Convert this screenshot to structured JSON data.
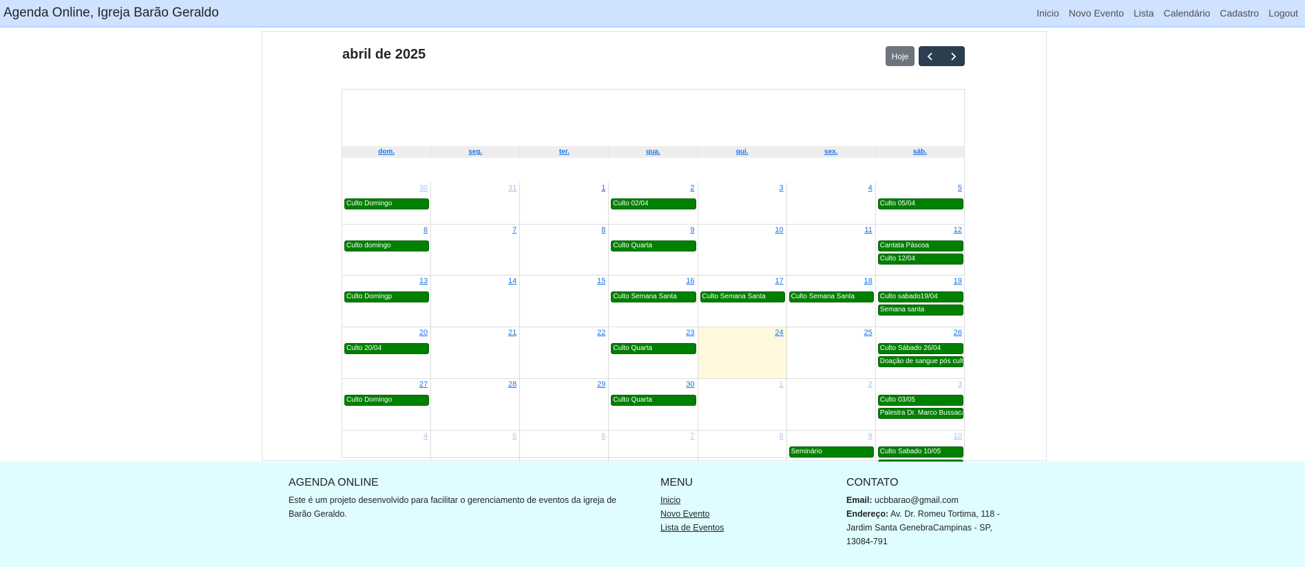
{
  "navbar": {
    "brand": "Agenda Online, Igreja Barão Geraldo",
    "links": [
      "Inicio",
      "Novo Evento",
      "Lista",
      "Calendário",
      "Cadastro",
      "Logout"
    ]
  },
  "calendar": {
    "title": "abril de 2025",
    "today_button": "Hoje",
    "prev_icon": "chevron-left-icon",
    "next_icon": "chevron-right-icon",
    "weekdays": [
      "dom.",
      "seg.",
      "ter.",
      "qua.",
      "qui.",
      "sex.",
      "sáb."
    ],
    "event_color": "#008000",
    "today_color": "#fff8dc",
    "weeks": [
      [
        {
          "num": "30",
          "other": true,
          "events": [
            "Culto Domingo"
          ]
        },
        {
          "num": "31",
          "other": true,
          "events": []
        },
        {
          "num": "1",
          "events": []
        },
        {
          "num": "2",
          "events": [
            "Culto 02/04"
          ]
        },
        {
          "num": "3",
          "events": []
        },
        {
          "num": "4",
          "events": []
        },
        {
          "num": "5",
          "events": [
            "Culto 05/04"
          ]
        }
      ],
      [
        {
          "num": "6",
          "events": [
            "Culto domingo"
          ]
        },
        {
          "num": "7",
          "events": []
        },
        {
          "num": "8",
          "events": []
        },
        {
          "num": "9",
          "events": [
            "Culto Quarta"
          ]
        },
        {
          "num": "10",
          "events": []
        },
        {
          "num": "11",
          "events": []
        },
        {
          "num": "12",
          "events": [
            "Cantata Páscoa",
            "Culto 12/04"
          ]
        }
      ],
      [
        {
          "num": "13",
          "events": [
            "Culto Domingp"
          ]
        },
        {
          "num": "14",
          "events": []
        },
        {
          "num": "15",
          "events": []
        },
        {
          "num": "16",
          "events": [
            "Culto Semana Santa"
          ]
        },
        {
          "num": "17",
          "events": [
            "Culto Semana Santa"
          ]
        },
        {
          "num": "18",
          "events": [
            "Culto Semana Santa"
          ]
        },
        {
          "num": "19",
          "events": [
            "Culto sabado19/04",
            "Semana santa"
          ]
        }
      ],
      [
        {
          "num": "20",
          "events": [
            "Culto 20/04"
          ]
        },
        {
          "num": "21",
          "events": []
        },
        {
          "num": "22",
          "events": []
        },
        {
          "num": "23",
          "events": [
            "Culto Quarta"
          ]
        },
        {
          "num": "24",
          "today": true,
          "events": []
        },
        {
          "num": "25",
          "events": []
        },
        {
          "num": "26",
          "events": [
            "Culto Sábado 26/04",
            "Doação de sangue pós culto"
          ]
        }
      ],
      [
        {
          "num": "27",
          "events": [
            "Culto Domingo"
          ]
        },
        {
          "num": "28",
          "events": []
        },
        {
          "num": "29",
          "events": []
        },
        {
          "num": "30",
          "events": [
            "Culto Quarta"
          ]
        },
        {
          "num": "1",
          "other": true,
          "events": []
        },
        {
          "num": "2",
          "other": true,
          "events": []
        },
        {
          "num": "3",
          "other": true,
          "events": [
            "Culto 03/05",
            "Palestra Dr. Marco Bussacarini"
          ]
        }
      ],
      [
        {
          "num": "4",
          "other": true,
          "events": []
        },
        {
          "num": "5",
          "other": true,
          "events": []
        },
        {
          "num": "6",
          "other": true,
          "events": []
        },
        {
          "num": "7",
          "other": true,
          "events": []
        },
        {
          "num": "8",
          "other": true,
          "events": []
        },
        {
          "num": "9",
          "other": true,
          "events": [
            "Seminário"
          ]
        },
        {
          "num": "10",
          "other": true,
          "events": [
            "Culto Sabado 10/05",
            "Seminário"
          ]
        }
      ]
    ]
  },
  "footer": {
    "about": {
      "heading": "AGENDA ONLINE",
      "text": "Este é um projeto desenvolvido para facilitar o gerenciamento de eventos da igreja de Barão Geraldo."
    },
    "menu": {
      "heading": "MENU",
      "links": [
        "Inicio",
        "Novo Evento",
        "Lista de Eventos"
      ]
    },
    "contact": {
      "heading": "CONTATO",
      "email_label": "Email:",
      "email": "ucbbarao@gmail.com",
      "address_label": "Endereço:",
      "address": "Av. Dr. Romeu Tortima, 118 - Jardim Santa GenebraCampinas - SP, 13084-791"
    }
  }
}
